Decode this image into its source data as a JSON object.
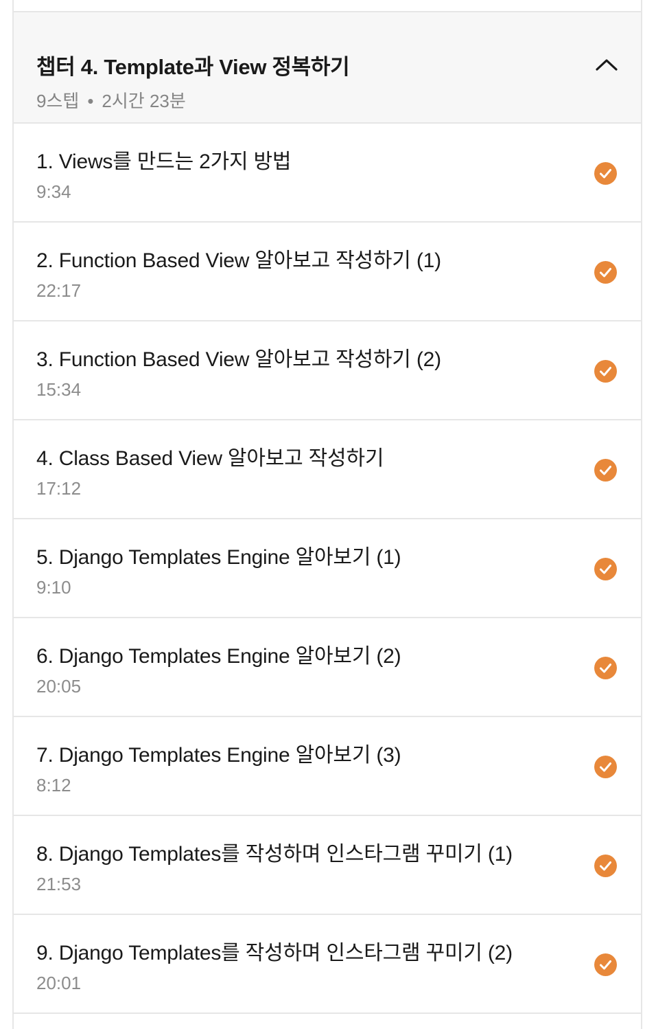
{
  "chapter": {
    "title": "챕터 4. Template과 View 정복하기",
    "steps": "9스텝",
    "separator": "•",
    "total_time": "2시간 23분",
    "toggle_icon": "chevron-up-icon"
  },
  "lessons": [
    {
      "title": "1. Views를 만드는 2가지 방법",
      "duration": "9:34",
      "status": "completed"
    },
    {
      "title": "2. Function Based View 알아보고 작성하기 (1)",
      "duration": "22:17",
      "status": "completed"
    },
    {
      "title": "3. Function Based View 알아보고 작성하기 (2)",
      "duration": "15:34",
      "status": "completed"
    },
    {
      "title": "4. Class Based View 알아보고 작성하기",
      "duration": "17:12",
      "status": "completed"
    },
    {
      "title": "5. Django Templates Engine 알아보기 (1)",
      "duration": "9:10",
      "status": "completed"
    },
    {
      "title": "6. Django Templates Engine 알아보기 (2)",
      "duration": "20:05",
      "status": "completed"
    },
    {
      "title": "7. Django Templates Engine 알아보기 (3)",
      "duration": "8:12",
      "status": "completed"
    },
    {
      "title": "8. Django Templates를 작성하며 인스타그램 꾸미기 (1)",
      "duration": "21:53",
      "status": "completed"
    },
    {
      "title": "9. Django Templates를 작성하며 인스타그램 꾸미기 (2)",
      "duration": "20:01",
      "status": "completed"
    }
  ],
  "colors": {
    "check": "#e8883a",
    "header_bg": "#f7f7f7",
    "border": "#e6e6e6",
    "muted_text": "#8c8c8c"
  }
}
